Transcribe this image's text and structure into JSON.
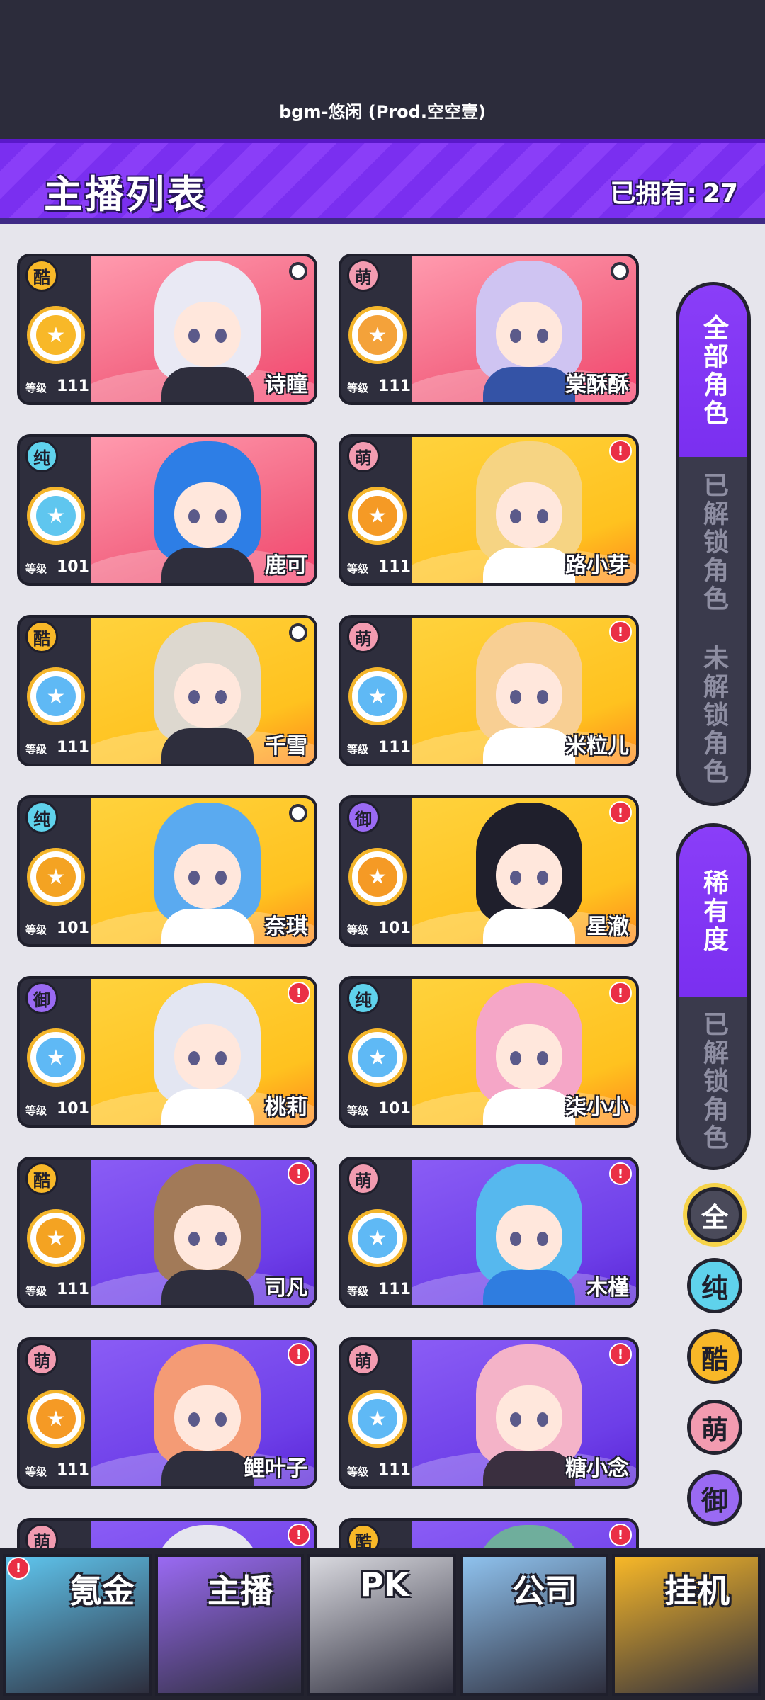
{
  "music": {
    "track": "bgm-悠闲 (Prod.空空壹)"
  },
  "header": {
    "title": "主播列表",
    "owned_label": "已拥有:",
    "owned_count": "27"
  },
  "level_label": "等级",
  "cards": [
    {
      "name": "诗瞳",
      "badge": "酷",
      "type": "cool",
      "level": "111",
      "bg": "pink",
      "corner": "dot",
      "hair": "#e9e9f4",
      "outfit": "#2e2e3d",
      "icon_color": "#f8b828"
    },
    {
      "name": "棠酥酥",
      "badge": "萌",
      "type": "cute",
      "level": "111",
      "bg": "pink",
      "corner": "dot",
      "hair": "#cfc4f2",
      "outfit": "#3453a6",
      "icon_color": "#f4a23a"
    },
    {
      "name": "鹿可",
      "badge": "纯",
      "type": "pure",
      "level": "101",
      "bg": "pink",
      "corner": "none",
      "hair": "#2d7ee6",
      "outfit": "#2e2e3d",
      "icon_color": "#5fc6ef"
    },
    {
      "name": "路小芽",
      "badge": "萌",
      "type": "cute",
      "level": "111",
      "bg": "yellow",
      "corner": "alert",
      "hair": "#f6d483",
      "outfit": "#ffffff",
      "icon_color": "#f59a25"
    },
    {
      "name": "千雪",
      "badge": "酷",
      "type": "cool",
      "level": "111",
      "bg": "yellow",
      "corner": "dot",
      "hair": "#ddd8cf",
      "outfit": "#2e2e3d",
      "icon_color": "#5fb9f5"
    },
    {
      "name": "米粒儿",
      "badge": "萌",
      "type": "cute",
      "level": "111",
      "bg": "yellow",
      "corner": "alert",
      "hair": "#f8cf93",
      "outfit": "#ffffff",
      "icon_color": "#5fb9f5"
    },
    {
      "name": "奈琪",
      "badge": "纯",
      "type": "pure",
      "level": "101",
      "bg": "yellow",
      "corner": "dot",
      "hair": "#5aaaf0",
      "outfit": "#ffffff",
      "icon_color": "#f4a322"
    },
    {
      "name": "星澈",
      "badge": "御",
      "type": "royal",
      "level": "101",
      "bg": "yellow",
      "corner": "alert",
      "hair": "#1f1f2c",
      "outfit": "#ffffff",
      "icon_color": "#f59a25"
    },
    {
      "name": "桃莉",
      "badge": "御",
      "type": "royal",
      "level": "101",
      "bg": "yellow",
      "corner": "alert",
      "hair": "#e3e6f2",
      "outfit": "#ffffff",
      "icon_color": "#5fb9f5"
    },
    {
      "name": "柒小小",
      "badge": "纯",
      "type": "pure",
      "level": "101",
      "bg": "yellow",
      "corner": "alert",
      "hair": "#f5a6c7",
      "outfit": "#ffffff",
      "icon_color": "#5fb9f5"
    },
    {
      "name": "司凡",
      "badge": "酷",
      "type": "cool",
      "level": "111",
      "bg": "purple",
      "corner": "alert",
      "hair": "#a27a58",
      "outfit": "#2e2e3d",
      "icon_color": "#f4a322"
    },
    {
      "name": "木槿",
      "badge": "萌",
      "type": "cute",
      "level": "111",
      "bg": "purple",
      "corner": "alert",
      "hair": "#56b8ee",
      "outfit": "#2f7de0",
      "icon_color": "#5fb9f5"
    },
    {
      "name": "鲤叶子",
      "badge": "萌",
      "type": "cute",
      "level": "111",
      "bg": "purple",
      "corner": "alert",
      "hair": "#f49b75",
      "outfit": "#2e2e3d",
      "icon_color": "#f59a25"
    },
    {
      "name": "糖小念",
      "badge": "萌",
      "type": "cute",
      "level": "111",
      "bg": "purple",
      "corner": "alert",
      "hair": "#f4b3c8",
      "outfit": "#3a2f3f",
      "icon_color": "#5fb9f5"
    },
    {
      "name": "",
      "badge": "萌",
      "type": "cute",
      "level": "",
      "bg": "purple",
      "corner": "alert",
      "hair": "#e6e6ee",
      "outfit": "#2e2e3d",
      "icon_color": "#f59a25"
    },
    {
      "name": "",
      "badge": "酷",
      "type": "cool",
      "level": "",
      "bg": "purple",
      "corner": "alert",
      "hair": "#6fae9c",
      "outfit": "#2e2e3d",
      "icon_color": "#f59a25"
    }
  ],
  "filters": {
    "group1": [
      {
        "label": "全部角色",
        "active": true
      },
      {
        "label": "已解锁角色",
        "active": false
      },
      {
        "label": "未解锁角色",
        "active": false
      }
    ],
    "group2": [
      {
        "label": "稀有度",
        "active": true
      },
      {
        "label": "已解锁角色",
        "active": false
      }
    ],
    "rarity": [
      {
        "label": "全",
        "type": "all"
      },
      {
        "label": "纯",
        "type": "pure"
      },
      {
        "label": "酷",
        "type": "cool"
      },
      {
        "label": "萌",
        "type": "cute"
      },
      {
        "label": "御",
        "type": "royal"
      }
    ]
  },
  "nav": [
    {
      "label": "氪金",
      "name": "nav-krypton",
      "color": "#5fc6ef",
      "alert": true
    },
    {
      "label": "主播",
      "name": "nav-streamer",
      "color": "#9a6af3",
      "alert": false
    },
    {
      "label": "PK",
      "name": "nav-pk",
      "color": "#d9d9df",
      "alert": false
    },
    {
      "label": "公司",
      "name": "nav-company",
      "color": "#8fc2ee",
      "alert": false
    },
    {
      "label": "挂机",
      "name": "nav-idle",
      "color": "#f8b828",
      "alert": false
    }
  ],
  "colors": {
    "accent": "#7a2ff0",
    "dark": "#2c2c3b",
    "alert": "#ea2f45"
  }
}
